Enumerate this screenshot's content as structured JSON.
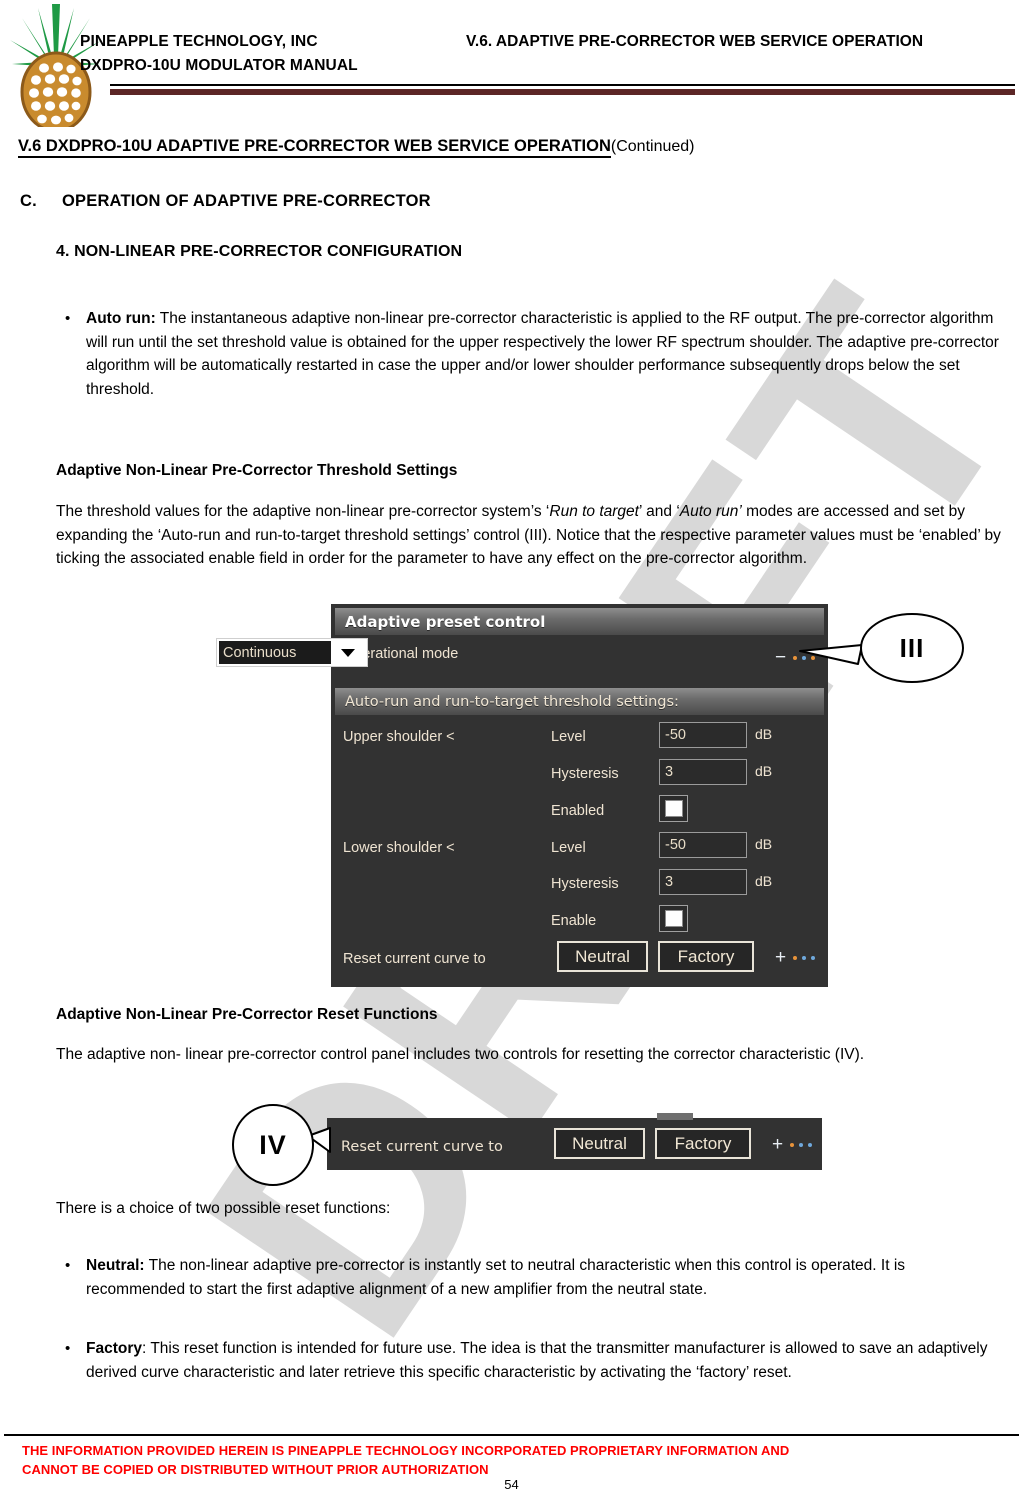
{
  "header": {
    "company_line1": "PINEAPPLE TECHNOLOGY, INC",
    "company_line2": "DXDPRO-10U MODULATOR MANUAL",
    "doc_title": "V.6. ADAPTIVE PRE-CORRECTOR WEB SERVICE OPERATION",
    "logo_name": "pineapple-logo"
  },
  "headings": {
    "section_v6": "V.6  DXDPRO-10U ADAPTIVE PRE-CORRECTOR WEB SERVICE OPERATION",
    "section_v6_suffix": "(Continued)",
    "section_c_label": "C.",
    "section_c": "OPERATION OF ADAPTIVE PRE-CORRECTOR",
    "subsection_4": "4. NON-LINEAR PRE-CORRECTOR CONFIGURATION",
    "threshold_settings": "Adaptive Non-Linear Pre-Corrector Threshold Settings",
    "reset_functions": "Adaptive Non-Linear Pre-Corrector Reset Functions"
  },
  "bullets": {
    "auto_run_label": "Auto run:",
    "auto_run_text": " The instantaneous adaptive non-linear pre-corrector characteristic is applied to the RF output. The pre-corrector algorithm will run until the set threshold value is obtained for the upper respectively the lower RF spectrum shoulder. The adaptive pre-corrector algorithm will be automatically restarted in case the upper and/or lower shoulder performance subsequently drops below the set threshold.",
    "neutral_label": "Neutral:",
    "neutral_text": " The non-linear adaptive pre-corrector is instantly set to neutral characteristic when this control is operated. It is recommended to start the first adaptive alignment of a new amplifier from the neutral state.",
    "factory_label": "Factory",
    "factory_text": ": This reset function is intended for future use. The idea is that the transmitter manufacturer is allowed to save an adaptively derived curve characteristic and later retrieve this specific characteristic by activating the ‘factory’ reset.",
    "marker": "•"
  },
  "paragraphs": {
    "threshold_p1": "The threshold values for the adaptive non-linear pre-corrector system’s ‘",
    "threshold_em1": "Run to target",
    "threshold_p2": "’ and ‘",
    "threshold_em2": "Auto run’",
    "threshold_p3": " modes  are accessed and set by expanding the ‘Auto-run and run-to-target threshold settings’ control (III). Notice that the respective parameter values must be ‘enabled’  by ticking the associated enable field in order for the parameter to have any effect on the pre-corrector algorithm.",
    "reset_p": "The adaptive non- linear pre-corrector control panel includes two controls for resetting the corrector characteristic (IV).",
    "choice_p": "There is a choice of two possible reset functions:"
  },
  "panel": {
    "title": "Adaptive preset control",
    "operational_mode_label": "Operational mode",
    "operational_mode_value": "Continuous",
    "subheader": "Auto-run and run-to-target threshold settings:",
    "upper_shoulder_label": "Upper shoulder  <",
    "lower_shoulder_label": "Lower shoulder  <",
    "level_label": "Level",
    "hysteresis_label": "Hysteresis",
    "enabled_label": "Enabled",
    "enable_label": "Enable",
    "upper_level_value": "-50",
    "upper_level_unit": "dB",
    "upper_hysteresis_value": "3",
    "upper_hysteresis_unit": "dB",
    "lower_level_value": "-50",
    "lower_level_unit": "dB",
    "lower_hysteresis_value": "3",
    "lower_hysteresis_unit": "dB",
    "reset_label": "Reset current curve to",
    "neutral_button": "Neutral",
    "factory_button": "Factory",
    "collapse_sign": "−",
    "expand_sign": "+"
  },
  "panel2": {
    "reset_label": "Reset current curve to",
    "neutral_button": "Neutral",
    "factory_button": "Factory",
    "expand_sign": "+"
  },
  "callouts": {
    "three": "III",
    "four": "IV"
  },
  "watermark": "DRAFT",
  "footer": {
    "notice_line1": "THE INFORMATION PROVIDED HEREIN IS PINEAPPLE TECHNOLOGY INCORPORATED PROPRIETARY INFORMATION AND",
    "notice_line2": "CANNOT BE COPIED OR DISTRIBUTED WITHOUT PRIOR AUTHORIZATION",
    "page_number": "54",
    "notice_color": "#ff0000"
  }
}
